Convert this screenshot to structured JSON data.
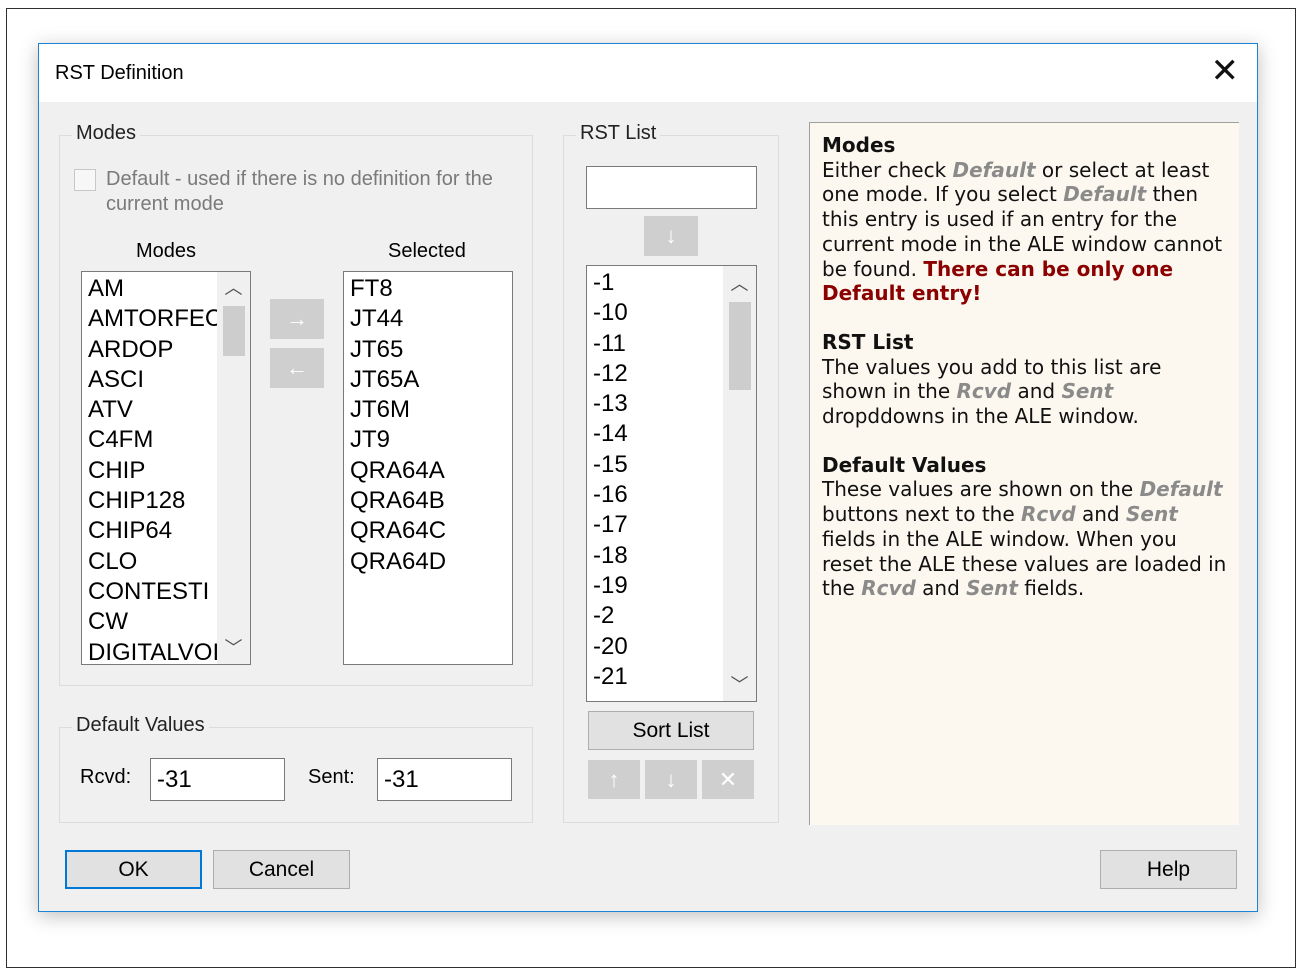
{
  "dialog": {
    "title": "RST Definition",
    "close_glyph": "✕"
  },
  "modes_group": {
    "label": "Modes",
    "default_checkbox_label_line1": "Default - used if there is no definition for the",
    "default_checkbox_label_line2": "current mode",
    "modes_header": "Modes",
    "selected_header": "Selected",
    "modes_list": [
      "AM",
      "AMTORFEC",
      "ARDOP",
      "ASCI",
      "ATV",
      "C4FM",
      "CHIP",
      "CHIP128",
      "CHIP64",
      "CLO",
      "CONTESTI",
      "CW",
      "DIGITALVOICE"
    ],
    "selected_list": [
      "FT8",
      "JT44",
      "JT65",
      "JT65A",
      "JT6M",
      "JT9",
      "QRA64A",
      "QRA64B",
      "QRA64C",
      "QRA64D"
    ],
    "add_arrow": "→",
    "remove_arrow": "←"
  },
  "default_values": {
    "label": "Default Values",
    "rcvd_label": "Rcvd:",
    "rcvd_value": "-31",
    "sent_label": "Sent:",
    "sent_value": "-31"
  },
  "rst_list": {
    "label": "RST List",
    "input_value": "",
    "add_arrow": "↓",
    "items": [
      "-1",
      "-10",
      "-11",
      "-12",
      "-13",
      "-14",
      "-15",
      "-16",
      "-17",
      "-18",
      "-19",
      "-2",
      "-20",
      "-21"
    ],
    "sort_label": "Sort List",
    "move_up": "↑",
    "move_down": "↓",
    "delete_glyph": "✕"
  },
  "help": {
    "modes_heading": "Modes",
    "modes_t1": "Either check ",
    "modes_default1": "Default",
    "modes_t2": " or select at least one mode. If you select ",
    "modes_default2": "Default",
    "modes_t3": " then this entry is used if an entry for the current mode in the ALE window cannot be found. ",
    "modes_warn": "There can be only one Default entry!",
    "rst_heading": "RST List",
    "rst_t1": "The values you add to this list are shown in the ",
    "rst_rcvd": "Rcvd",
    "rst_t2": " and ",
    "rst_sent": "Sent",
    "rst_t3": " dropddowns in the ALE window.",
    "dv_heading": "Default Values",
    "dv_t1": "These values are shown on the ",
    "dv_default": "Default",
    "dv_t2": " buttons next to the ",
    "dv_rcvd": "Rcvd",
    "dv_t3": " and ",
    "dv_sent": "Sent",
    "dv_t4": " fields in the ALE window. When you reset the ALE these values are loaded in the ",
    "dv_rcvd2": "Rcvd",
    "dv_t5": " and ",
    "dv_sent2": "Sent",
    "dv_t6": " fields."
  },
  "footer": {
    "ok": "OK",
    "cancel": "Cancel",
    "help": "Help"
  }
}
